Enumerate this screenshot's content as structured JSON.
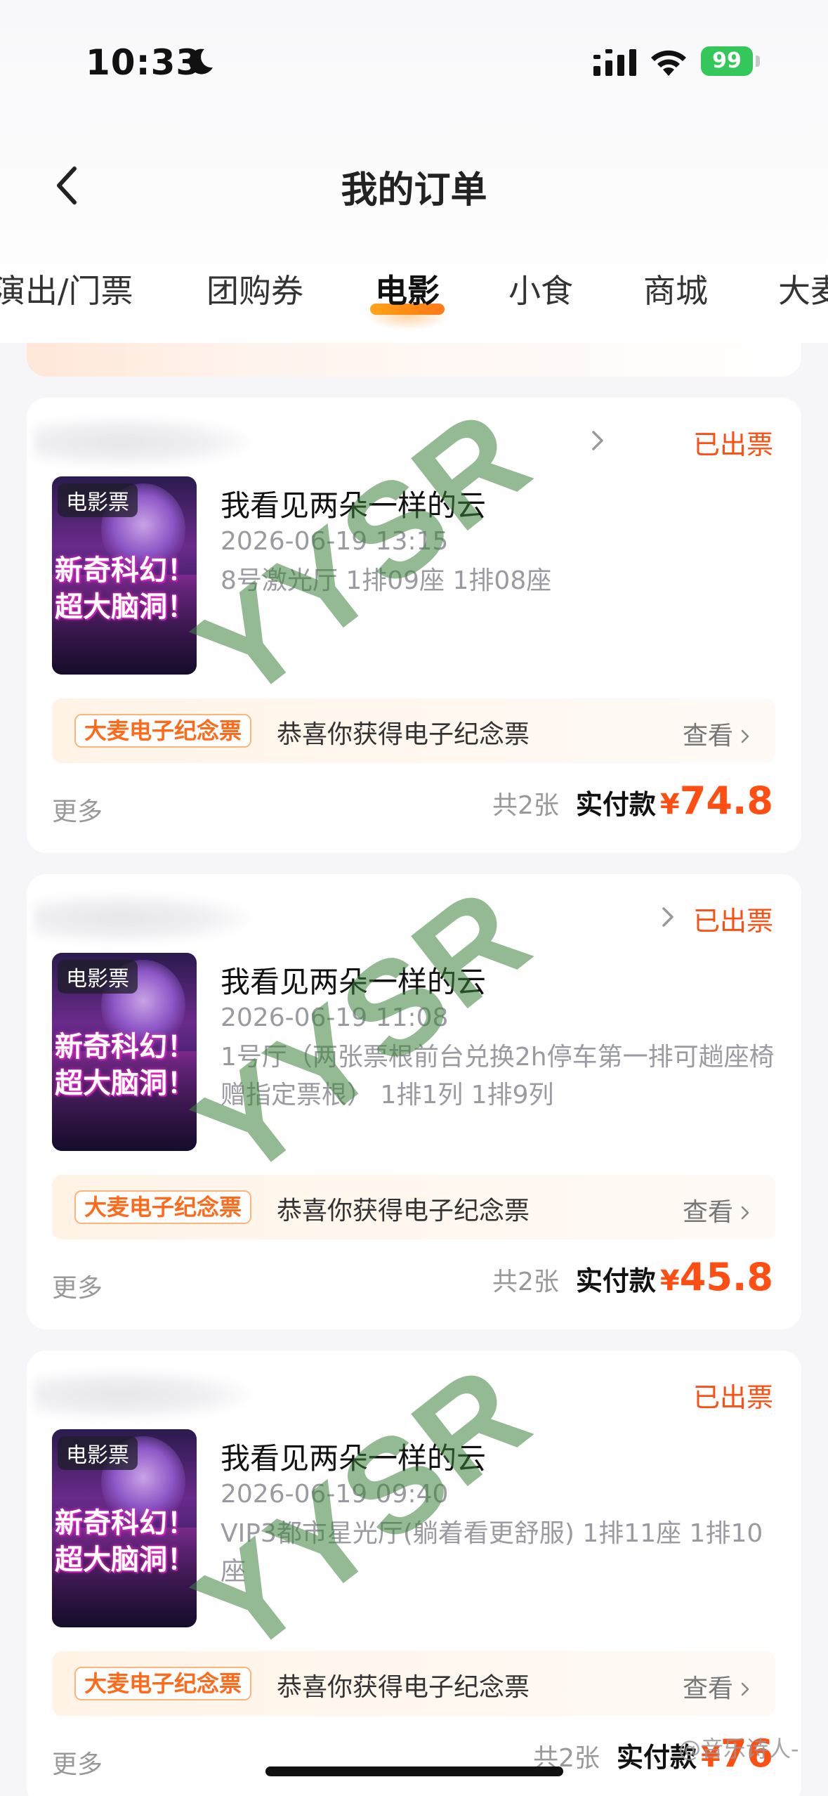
{
  "status_bar": {
    "time": "10:33",
    "battery": "99"
  },
  "header": {
    "title": "我的订单"
  },
  "tabs": [
    {
      "label": "演出/门票"
    },
    {
      "label": "团购券"
    },
    {
      "label": "电影"
    },
    {
      "label": "小食"
    },
    {
      "label": "商城"
    },
    {
      "label": "大麦"
    }
  ],
  "orders": [
    {
      "status": "已出票",
      "poster_tag": "电影票",
      "poster_slogan": "新奇科幻！超大脑洞！",
      "movie_title": "我看见两朵一样的云",
      "show_time": "2026-06-19 13:15",
      "seat_info": "8号激光厅 1排09座 1排08座",
      "souvenir_badge": "大麦电子纪念票",
      "souvenir_text": "恭喜你获得电子纪念票",
      "view_label": "查看",
      "more_label": "更多",
      "ticket_count": "共2张",
      "paid_label": "实付款",
      "currency": "¥",
      "price": "74.8"
    },
    {
      "status": "已出票",
      "poster_tag": "电影票",
      "poster_slogan": "新奇科幻！超大脑洞！",
      "movie_title": "我看见两朵一样的云",
      "show_time": "2026-06-19 11:08",
      "seat_info": "1号厅（两张票根前台兑换2h停车第一排可趟座椅赠指定票根） 1排1列 1排9列",
      "souvenir_badge": "大麦电子纪念票",
      "souvenir_text": "恭喜你获得电子纪念票",
      "view_label": "查看",
      "more_label": "更多",
      "ticket_count": "共2张",
      "paid_label": "实付款",
      "currency": "¥",
      "price": "45.8"
    },
    {
      "status": "已出票",
      "poster_tag": "电影票",
      "poster_slogan": "新奇科幻！超大脑洞！",
      "movie_title": "我看见两朵一样的云",
      "show_time": "2026-06-19 09:40",
      "seat_info": "VIP3都市星光厅(躺着看更舒服) 1排11座 1排10座",
      "souvenir_badge": "大麦电子纪念票",
      "souvenir_text": "恭喜你获得电子纪念票",
      "view_label": "查看",
      "more_label": "更多",
      "ticket_count": "共2张",
      "paid_label": "实付款",
      "currency": "¥",
      "price": "76"
    }
  ],
  "watermark": "YYSR",
  "weibo_mark": "@音乐诗人-",
  "colors": {
    "accent": "#ff4e12",
    "tab_underline": "#ff8a00",
    "battery": "#34c759"
  }
}
